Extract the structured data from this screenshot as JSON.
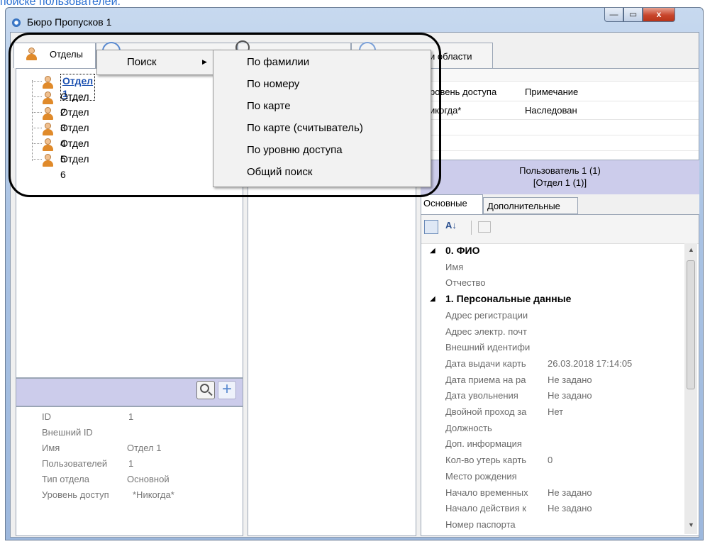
{
  "top_link": "поиске пользователей.",
  "window": {
    "title": "Бюро Пропусков 1",
    "min": "—",
    "max": "▭",
    "close": "x"
  },
  "tabs": {
    "departments": "Отделы",
    "areas_label": "и области"
  },
  "tree": [
    "Отдел 1",
    "Отдел 2",
    "Отдел 3",
    "Отдел 4",
    "Отдел 5",
    "Отдел 6"
  ],
  "context_menu": {
    "search": "Поиск",
    "arrow": "▶"
  },
  "submenu": [
    "По фамилии",
    "По номеру",
    "По карте",
    "По карте (считыватель)",
    "По уровню доступа",
    "Общий поиск"
  ],
  "table": {
    "headers": [
      "ровень доступа",
      "Примечание"
    ],
    "rows": [
      [
        "икогда*",
        "Наследован"
      ]
    ]
  },
  "user_header": {
    "line1": "Пользователь 1 (1)",
    "line2": "[Отдел 1 (1)]"
  },
  "prop_tabs": [
    "Основные",
    "Дополнительные"
  ],
  "props": [
    {
      "type": "cat",
      "name": "0. ФИО"
    },
    {
      "name": "Имя",
      "value": ""
    },
    {
      "name": "Отчество",
      "value": ""
    },
    {
      "type": "cat",
      "name": "1. Персональные данные"
    },
    {
      "name": "Адрес регистрации",
      "value": ""
    },
    {
      "name": "Адрес электр. почт",
      "value": ""
    },
    {
      "name": "Внешний идентифи",
      "value": ""
    },
    {
      "name": "Дата выдачи карть",
      "value": "26.03.2018 17:14:05"
    },
    {
      "name": "Дата приема на ра",
      "value": "Не задано"
    },
    {
      "name": "Дата увольнения",
      "value": "Не задано"
    },
    {
      "name": "Двойной проход за",
      "value": "Нет"
    },
    {
      "name": "Должность",
      "value": ""
    },
    {
      "name": "Доп. информация",
      "value": ""
    },
    {
      "name": "Кол-во утерь карть",
      "value": "0"
    },
    {
      "name": "Место рождения",
      "value": ""
    },
    {
      "name": "Начало временных",
      "value": "Не задано"
    },
    {
      "name": "Начало действия к",
      "value": "Не задано"
    },
    {
      "name": "Номер паспорта",
      "value": ""
    }
  ],
  "dept_info": [
    {
      "label": "ID",
      "value": "1"
    },
    {
      "label": "Внешний ID",
      "value": ""
    },
    {
      "label": "Имя",
      "value": "Отдел 1"
    },
    {
      "label": "Пользователей",
      "value": "1"
    },
    {
      "label": "Тип отдела",
      "value": "Основной"
    },
    {
      "label": "Уровень доступ",
      "value": "*Никогда*"
    }
  ],
  "colors": {
    "accent_blue": "#2a6fd1",
    "panel_purple": "#cccceb",
    "callout": "#000000"
  }
}
